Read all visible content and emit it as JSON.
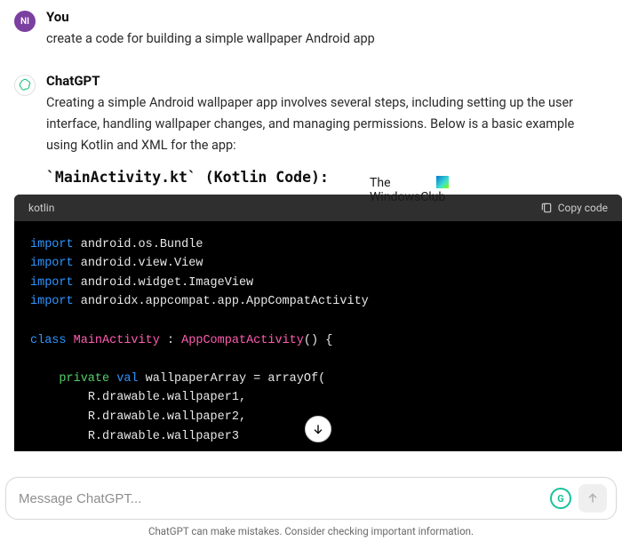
{
  "user": {
    "label": "You",
    "initials": "NI",
    "text": "create a code for building a simple wallpaper Android app"
  },
  "assistant": {
    "label": "ChatGPT",
    "intro": "Creating a simple Android wallpaper app involves several steps, including setting up the user interface, handling wallpaper changes, and managing permissions. Below is a basic example using Kotlin and XML for the app:",
    "heading": "`MainActivity.kt` (Kotlin Code):",
    "code": {
      "language": "kotlin",
      "copy_label": "Copy code",
      "lines": {
        "kw_import": "import",
        "i1": "android.os.Bundle",
        "i2": "android.view.View",
        "i3": "android.widget.ImageView",
        "i4": "androidx.appcompat.app.AppCompatActivity",
        "kw_class": "class",
        "cls_name": "MainActivity",
        "super": "AppCompatActivity",
        "kw_private": "private",
        "kw_val": "val",
        "field": "wallpaperArray = arrayOf(",
        "a1": "R.drawable.wallpaper1,",
        "a2": "R.drawable.wallpaper2,",
        "a3": "R.drawable.wallpaper3"
      }
    }
  },
  "watermark": {
    "line1": "The",
    "line2": "WindowsClub"
  },
  "composer": {
    "placeholder": "Message ChatGPT..."
  },
  "footer": "ChatGPT can make mistakes. Consider checking important information."
}
